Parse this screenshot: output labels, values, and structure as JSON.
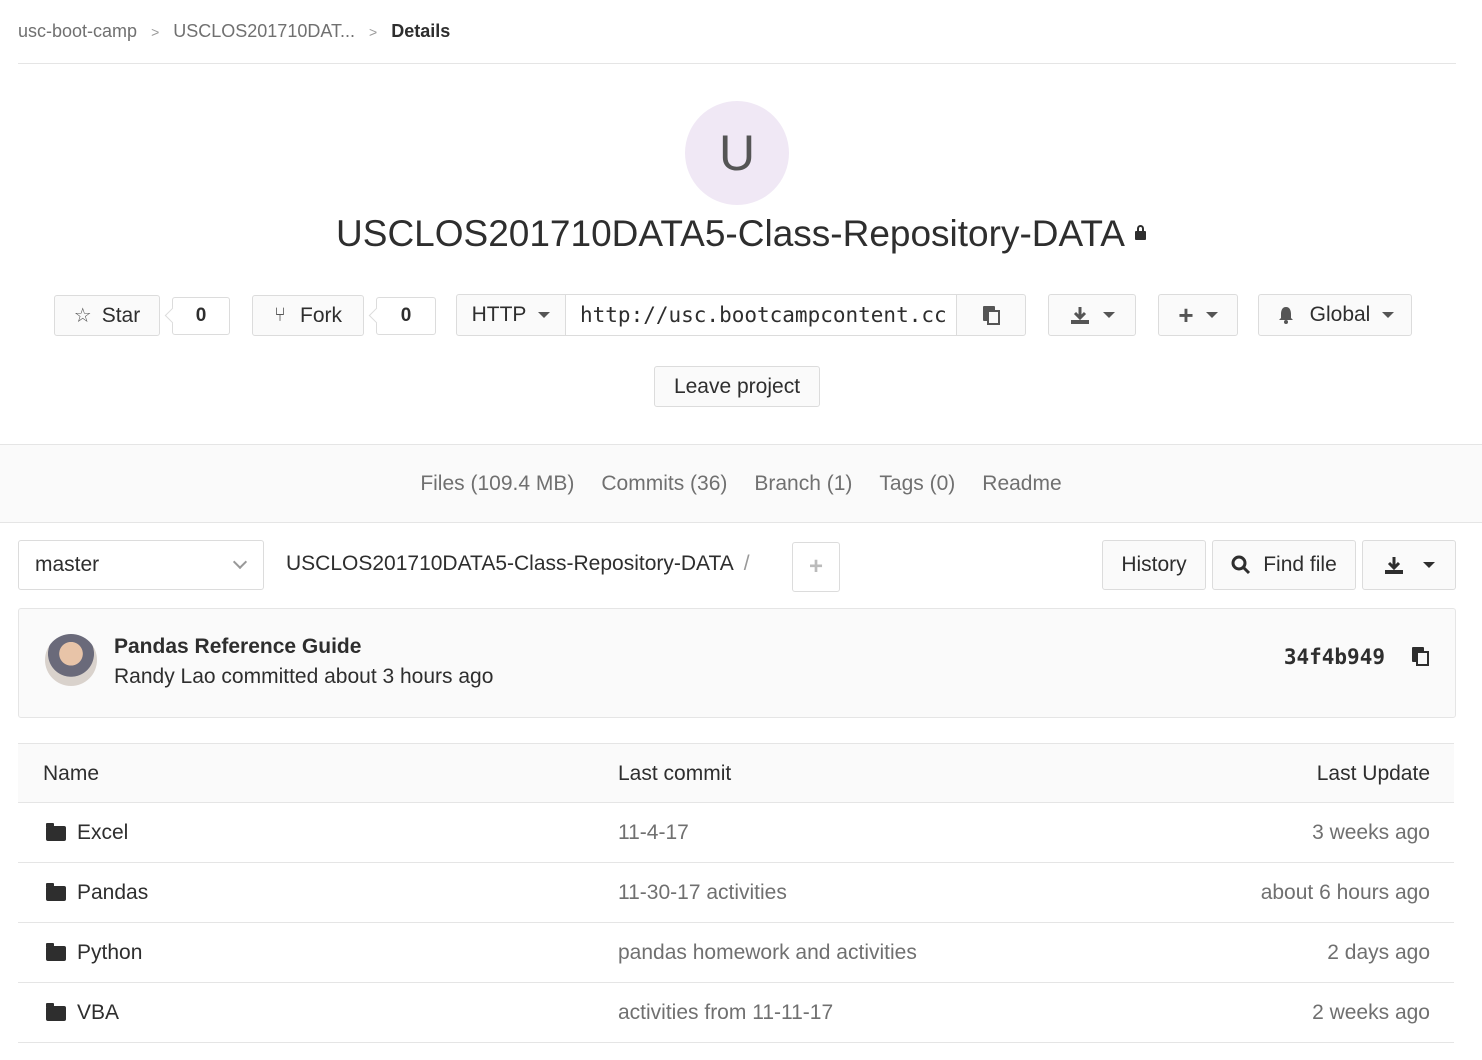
{
  "breadcrumb": {
    "items": [
      "usc-boot-camp",
      "USCLOS201710DAT...",
      "Details"
    ]
  },
  "project": {
    "avatar_letter": "U",
    "name": "USCLOS201710DATA5-Class-Repository-DATA"
  },
  "actions": {
    "star_label": "Star",
    "star_count": "0",
    "fork_label": "Fork",
    "fork_count": "0",
    "protocol": "HTTP",
    "clone_url": "http://usc.bootcampcontent.cc",
    "notification_level": "Global",
    "leave_label": "Leave project"
  },
  "nav": {
    "files": "Files (109.4 MB)",
    "commits": "Commits (36)",
    "branch": "Branch (1)",
    "tags": "Tags (0)",
    "readme": "Readme"
  },
  "tree": {
    "branch": "master",
    "path": "USCLOS201710DATA5-Class-Repository-DATA",
    "path_sep": "/",
    "history_label": "History",
    "find_file_label": "Find file"
  },
  "last_commit": {
    "title": "Pandas Reference Guide",
    "meta": "Randy Lao committed about 3 hours ago",
    "sha": "34f4b949"
  },
  "table": {
    "headers": {
      "name": "Name",
      "last_commit": "Last commit",
      "last_update": "Last Update"
    },
    "rows": [
      {
        "name": "Excel",
        "commit": "11-4-17",
        "updated": "3 weeks ago"
      },
      {
        "name": "Pandas",
        "commit": "11-30-17 activities",
        "updated": "about 6 hours ago"
      },
      {
        "name": "Python",
        "commit": "pandas homework and activities",
        "updated": "2 days ago"
      },
      {
        "name": "VBA",
        "commit": "activities from 11-11-17",
        "updated": "2 weeks ago"
      }
    ]
  },
  "colors": {
    "border": "#e5e5e5",
    "avatar_bg": "#f0e8f5",
    "muted_text": "#707070"
  }
}
